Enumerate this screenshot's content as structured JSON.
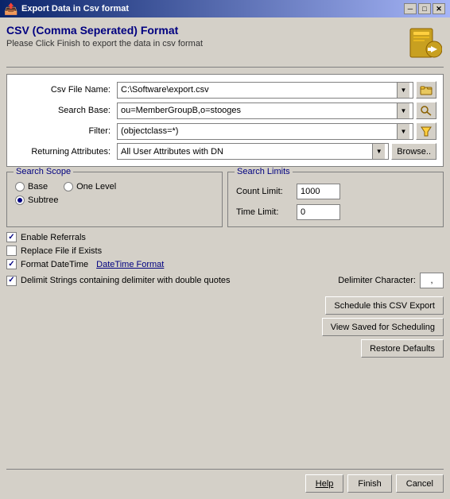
{
  "titleBar": {
    "icon": "📤",
    "title": "Export Data in Csv format",
    "closeBtn": "✕",
    "maxBtn": "□",
    "minBtn": "─"
  },
  "header": {
    "title": "CSV (Comma Seperated) Format",
    "subtitle": "Please Click Finish to export the data in csv format"
  },
  "form": {
    "csvFileNameLabel": "Csv File Name:",
    "csvFileNameValue": "C:\\Software\\export.csv",
    "searchBaseLabel": "Search Base:",
    "searchBaseValue": "ou=MemberGroupB,o=stooges",
    "filterLabel": "Filter:",
    "filterValue": "(objectclass=*)",
    "returningAttrLabel": "Returning Attributes:",
    "returningAttrValue": "All User Attributes with DN",
    "browseBtn": "Browse.."
  },
  "searchScope": {
    "title": "Search Scope",
    "baseLabel": "Base",
    "oneLevelLabel": "One Level",
    "subtreeLabel": "Subtree",
    "baseChecked": false,
    "oneLevelChecked": false,
    "subtreeChecked": true
  },
  "searchLimits": {
    "title": "Search Limits",
    "countLimitLabel": "Count Limit:",
    "countLimitValue": "1000",
    "timeLimitLabel": "Time Limit:",
    "timeLimitValue": "0"
  },
  "checkboxes": {
    "enableReferrals": {
      "label": "Enable Referrals",
      "checked": true
    },
    "replaceFile": {
      "label": "Replace File if Exists",
      "checked": false
    },
    "formatDateTime": {
      "label": "Format DateTime",
      "checked": true,
      "linkText": "DateTime Format"
    },
    "delimitStrings": {
      "label": "Delimit Strings containing delimiter with double quotes",
      "checked": true,
      "delimiterCharLabel": "Delimiter Character:",
      "delimiterCharValue": ","
    }
  },
  "actionButtons": {
    "schedule": "Schedule this CSV Export",
    "viewSaved": "View Saved for Scheduling",
    "restoreDefaults": "Restore Defaults"
  },
  "bottomButtons": {
    "help": "Help",
    "finish": "Finish",
    "cancel": "Cancel"
  }
}
